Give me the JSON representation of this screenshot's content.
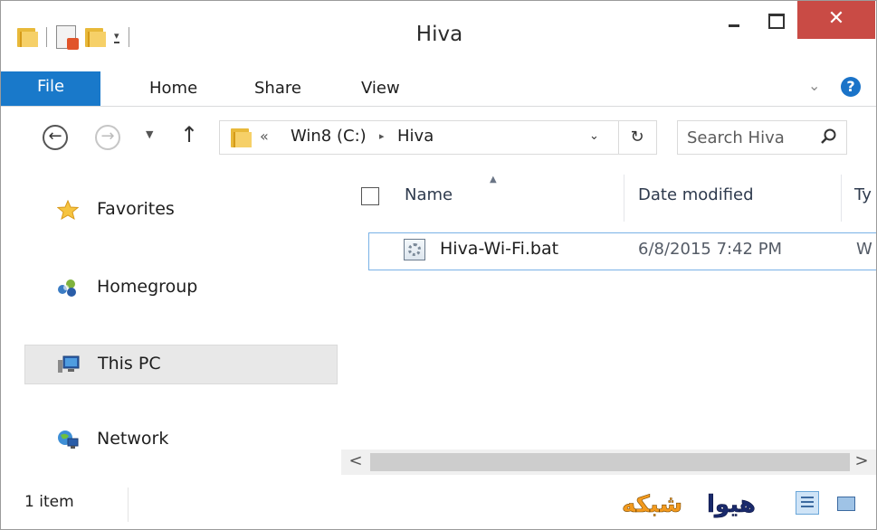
{
  "window": {
    "title": "Hiva",
    "close_glyph": "✕",
    "quick_access_arrow": "▾"
  },
  "ribbon": {
    "tabs": [
      "File",
      "Home",
      "Share",
      "View"
    ],
    "chevron": "⌄",
    "help": "?"
  },
  "address": {
    "back_glyph": "←",
    "forward_glyph": "→",
    "recent_glyph": "▼",
    "up_glyph": "↑",
    "overflow": "«",
    "breadcrumb": [
      "Win8 (C:)",
      "Hiva"
    ],
    "separator": "▸",
    "dropdown_glyph": "⌄",
    "refresh_glyph": "↻",
    "search_placeholder": "Search Hiva"
  },
  "nav_pane": {
    "items": [
      {
        "label": "Favorites",
        "icon": "star-icon"
      },
      {
        "label": "Homegroup",
        "icon": "homegroup-icon"
      },
      {
        "label": "This PC",
        "icon": "computer-icon",
        "selected": true
      },
      {
        "label": "Network",
        "icon": "network-icon"
      }
    ]
  },
  "content": {
    "columns": [
      "Name",
      "Date modified",
      "Ty"
    ],
    "sort_indicator": "▲",
    "files": [
      {
        "name": "Hiva-Wi-Fi.bat",
        "date_modified": "6/8/2015 7:42 PM",
        "type": "W",
        "icon": "batch-file-icon"
      }
    ],
    "scroll_left": "<",
    "scroll_right": ">"
  },
  "status_bar": {
    "item_count": "1 item",
    "watermark": "هیوا شبکه",
    "watermark_parts": [
      "شبکه",
      "هیوا"
    ]
  },
  "colors": {
    "file_tab": "#1979ca",
    "close_button": "#c94b45",
    "selection_border": "#7ab2e6",
    "watermark_orange": "#f39a1e",
    "watermark_navy": "#1a2a6c"
  }
}
